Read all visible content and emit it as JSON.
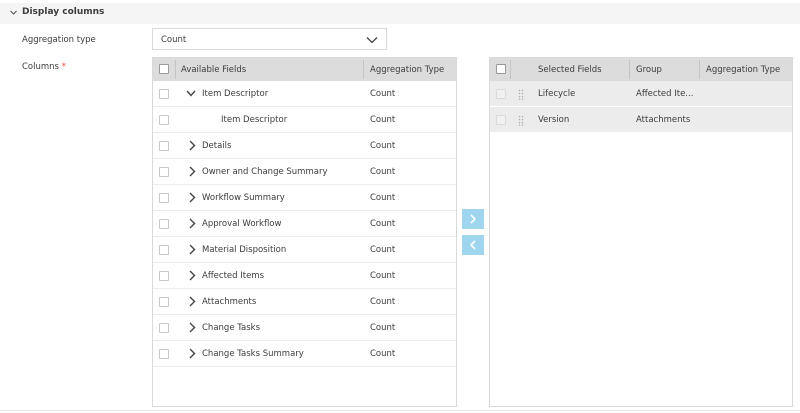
{
  "section": {
    "title": "Display columns",
    "icon": "chevron-down-icon"
  },
  "aggregation": {
    "label": "Aggregation type",
    "value": "Count",
    "icon": "chevron-down-icon"
  },
  "columns": {
    "label": "Columns",
    "required_mark": "*"
  },
  "available": {
    "headers": {
      "fields": "Available Fields",
      "aggregation": "Aggregation Type"
    },
    "rows": [
      {
        "name": "Item Descriptor",
        "agg": "Count",
        "toggle": "chevron-down-icon"
      },
      {
        "name": "Item Descriptor",
        "agg": "Count",
        "toggle": ""
      },
      {
        "name": "Details",
        "agg": "Count",
        "toggle": "chevron-right-icon"
      },
      {
        "name": "Owner and Change Summary",
        "agg": "Count",
        "toggle": "chevron-right-icon"
      },
      {
        "name": "Workflow Summary",
        "agg": "Count",
        "toggle": "chevron-right-icon"
      },
      {
        "name": "Approval Workflow",
        "agg": "Count",
        "toggle": "chevron-right-icon"
      },
      {
        "name": "Material Disposition",
        "agg": "Count",
        "toggle": "chevron-right-icon"
      },
      {
        "name": "Affected Items",
        "agg": "Count",
        "toggle": "chevron-right-icon"
      },
      {
        "name": "Attachments",
        "agg": "Count",
        "toggle": "chevron-right-icon"
      },
      {
        "name": "Change Tasks",
        "agg": "Count",
        "toggle": "chevron-right-icon"
      },
      {
        "name": "Change Tasks Summary",
        "agg": "Count",
        "toggle": "chevron-right-icon"
      }
    ]
  },
  "buttons": {
    "add_icon": "chevron-right-icon",
    "remove_icon": "chevron-left-icon",
    "color": "#9fd5ee"
  },
  "selected": {
    "headers": {
      "fields": "Selected Fields",
      "group": "Group",
      "aggregation": "Aggregation Type"
    },
    "rows": [
      {
        "field": "Lifecycle",
        "group": "Affected Ite...",
        "agg": ""
      },
      {
        "field": "Version",
        "group": "Attachments",
        "agg": ""
      }
    ]
  },
  "colors": {
    "header_bg": "#dcdcdc",
    "required": "#e04a3f",
    "selected_row": "#ececec"
  }
}
